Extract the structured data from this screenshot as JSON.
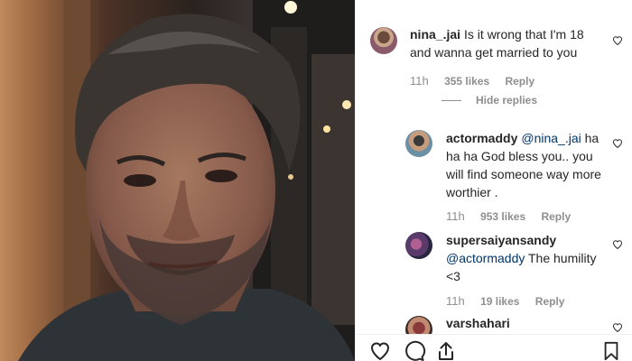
{
  "photo": {
    "alt_subject": "selfie"
  },
  "comments": [
    {
      "username": "nina_.jai",
      "text": "Is it wrong that I'm 18 and wanna get married to you",
      "time": "11h",
      "likes": "355 likes",
      "reply": "Reply"
    }
  ],
  "hide_replies": "Hide replies",
  "replies": [
    {
      "username": "actormaddy",
      "mention": "@nina_.jai",
      "text_line1": " ha",
      "text_line2": "ha ha God bless you.. you",
      "text_line3": "will find someone way more",
      "text_line4": "worthier .",
      "time": "11h",
      "likes": "953 likes",
      "reply": "Reply"
    },
    {
      "username": "supersaiyansandy",
      "mention": "@actormaddy",
      "text": " The humility",
      "text_line2": "<3",
      "time": "11h",
      "likes": "19 likes",
      "reply": "Reply"
    },
    {
      "username": "varshahari"
    }
  ],
  "icons": {
    "like": "heart-icon",
    "comment": "comment-icon",
    "share": "share-icon",
    "save": "bookmark-icon"
  },
  "colors": {
    "muted": "#8e8e8e",
    "mention": "#003569",
    "text": "#262626"
  }
}
